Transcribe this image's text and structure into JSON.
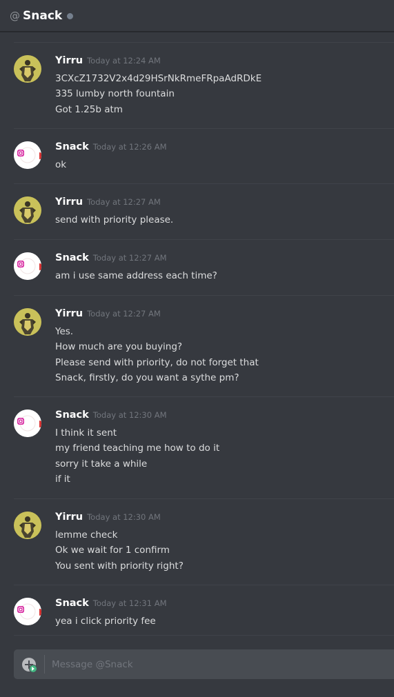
{
  "header": {
    "at_symbol": "@",
    "channel": "Snack"
  },
  "messages": [
    {
      "author": "Yirru",
      "timestamp": "Today at 12:24 AM",
      "avatar": "yirru",
      "lines": [
        "3CXcZ1732V2x4d29HSrNkRmeFRpaAdRDkE",
        "335 lumby north fountain",
        "Got 1.25b atm"
      ]
    },
    {
      "author": "Snack",
      "timestamp": "Today at 12:26 AM",
      "avatar": "snack",
      "lines": [
        "ok"
      ]
    },
    {
      "author": "Yirru",
      "timestamp": "Today at 12:27 AM",
      "avatar": "yirru",
      "lines": [
        "send with priority please."
      ]
    },
    {
      "author": "Snack",
      "timestamp": "Today at 12:27 AM",
      "avatar": "snack",
      "lines": [
        "am i use same address each time?"
      ]
    },
    {
      "author": "Yirru",
      "timestamp": "Today at 12:27 AM",
      "avatar": "yirru",
      "lines": [
        "Yes.",
        "How much are you buying?",
        "Please send with priority, do not forget that",
        "Snack, firstly, do you want a sythe pm?"
      ]
    },
    {
      "author": "Snack",
      "timestamp": "Today at 12:30 AM",
      "avatar": "snack",
      "lines": [
        "I think it sent",
        "my friend teaching me how to do it",
        "sorry it take a while",
        "if it"
      ]
    },
    {
      "author": "Yirru",
      "timestamp": "Today at 12:30 AM",
      "avatar": "yirru",
      "lines": [
        "lemme check",
        "Ok we wait for 1 confirm",
        "You sent with priority right?"
      ]
    },
    {
      "author": "Snack",
      "timestamp": "Today at 12:31 AM",
      "avatar": "snack",
      "lines": [
        "yea i click priority fee"
      ]
    }
  ],
  "composer": {
    "placeholder": "Message @Snack",
    "value": ""
  },
  "icons": {
    "header_status": "offline-status-dot",
    "composer_add": "plus-circle-icon",
    "yirru_avatar": "armored-figure-avatar",
    "snack_avatar": "instagram-logo-avatar"
  },
  "colors": {
    "background": "#36393f",
    "text": "#dcddde",
    "author": "#ffffff",
    "timestamp": "#72767d",
    "composer": "#484c52",
    "status_offline": "#747f8d",
    "badge": "#43b581"
  }
}
